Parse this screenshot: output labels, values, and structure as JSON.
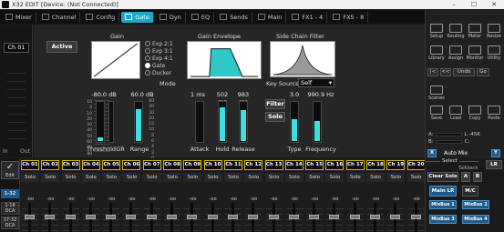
{
  "window": {
    "title": "X32 EDIT [Device: (Not Connected)]",
    "minimize": "–",
    "maximize": "☐",
    "close": "✕"
  },
  "tabs": [
    {
      "label": "Mixer",
      "icon": "mixer-icon"
    },
    {
      "label": "Channel",
      "icon": "channel-icon"
    },
    {
      "label": "Config",
      "icon": "config-icon"
    },
    {
      "label": "Gate",
      "icon": "gate-icon"
    },
    {
      "label": "Dyn",
      "icon": "dyn-icon"
    },
    {
      "label": "EQ",
      "icon": "eq-icon"
    },
    {
      "label": "Sends",
      "icon": "sends-icon"
    },
    {
      "label": "Main",
      "icon": "main-icon"
    },
    {
      "label": "FX1 - 4",
      "icon": "fx-icon"
    },
    {
      "label": "FX5 - 8",
      "icon": "fx-icon"
    }
  ],
  "active_tab_index": 3,
  "leftstrip": {
    "channel": "Ch 01",
    "in": "In",
    "out": "Out"
  },
  "gate": {
    "active_label": "Active",
    "gain_title": "Gain",
    "envelope_title": "Gain Envelope",
    "sidechain_title": "Side Chain Filter",
    "modes": [
      "Exp 2:1",
      "Exp 3:1",
      "Exp 4:1",
      "Gate",
      "Ducker"
    ],
    "selected_mode": "Gate",
    "mode_label": "Mode",
    "threshold": {
      "value": "-80.0 dB",
      "label": "Threshold",
      "level": 0.08
    },
    "gr_label": "GR",
    "range": {
      "value": "60.0 dB",
      "label": "Range",
      "level": 0.8
    },
    "attack": {
      "value": "1 ms",
      "label": "Attack",
      "level": 0.0
    },
    "hold": {
      "value": "502 ms",
      "label": "Hold",
      "level": 0.85
    },
    "release": {
      "value": "983 ms",
      "label": "Release",
      "level": 0.78
    },
    "key_source_label": "Key Source",
    "key_source_value": "Self",
    "filter_label": "Filter",
    "solo_label": "Solo",
    "type": {
      "value": "3.0",
      "label": "Type",
      "level": 0.55
    },
    "frequency": {
      "value": "990.9 Hz",
      "label": "Frequency",
      "level": 0.5
    },
    "left_scale": [
      "10",
      "0",
      "10",
      "20",
      "30",
      "40",
      "50",
      "60",
      "70",
      "80"
    ],
    "range_scale": [
      "60",
      "40",
      "30",
      "20",
      "15",
      "10",
      "8",
      "6",
      "4",
      "2",
      "0"
    ]
  },
  "right": {
    "top_buttons": [
      "Setup",
      "Routing",
      "Meter",
      "Resize",
      "Library",
      "Assign",
      "Monitor",
      "Utility"
    ],
    "undo_row": [
      "|<",
      "<<",
      "Undo",
      "Go"
    ],
    "scenes_label": "Scenes",
    "scene_buttons": [
      "Save",
      "Load",
      "Copy",
      "Paste"
    ],
    "meter_labels": [
      "A:",
      "B:",
      "L -45K",
      "C:"
    ]
  },
  "channels": [
    "Ch 01",
    "Ch 02",
    "Ch 03",
    "Ch 04",
    "Ch 05",
    "Ch 06",
    "Ch 07",
    "Ch 08",
    "Ch 09",
    "Ch 10",
    "Ch 11",
    "Ch 12",
    "Ch 13",
    "Ch 14",
    "Ch 15",
    "Ch 16",
    "Ch 17",
    "Ch 18",
    "Ch 19",
    "Ch 20"
  ],
  "solo_label": "Solo",
  "fader_value": "-oo",
  "leftnav": {
    "edit": "Edit",
    "bank1": "1-32",
    "bank2": "1-16\nDCA",
    "bank3": "17-32\nDCA"
  },
  "bottom": {
    "x": "X",
    "automix": "Auto Mix",
    "y": "Y",
    "select": "Select",
    "talkback": "Talkback",
    "lr": "LR",
    "clear_solo": "Clear Solo",
    "a": "A",
    "b": "B",
    "main_lr": "Main LR",
    "mc": "M/C",
    "mixbus": [
      "MixBus 1",
      "MixBus 2",
      "MixBus 3",
      "MixBus 4"
    ]
  }
}
